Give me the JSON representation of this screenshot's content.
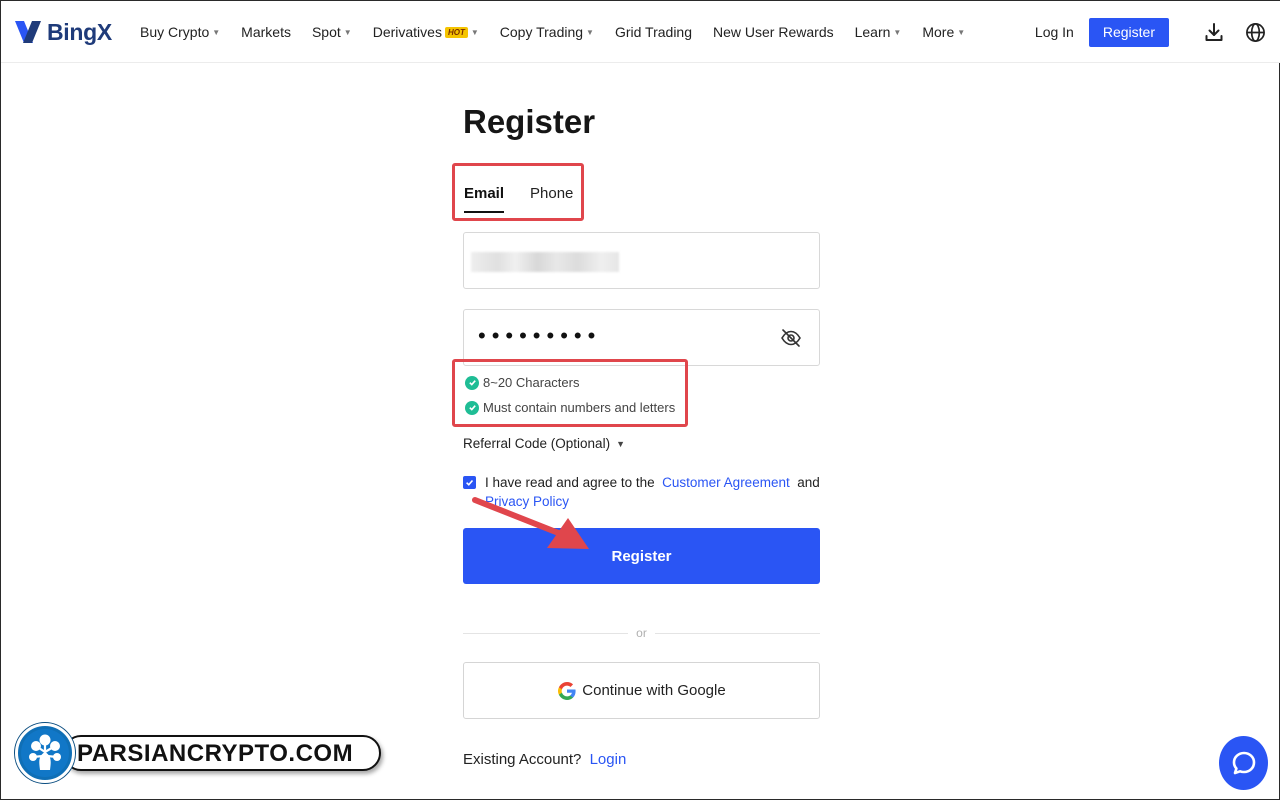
{
  "header": {
    "logo_text": "BingX",
    "nav": [
      {
        "label": "Buy Crypto",
        "caret": true
      },
      {
        "label": "Markets",
        "caret": false
      },
      {
        "label": "Spot",
        "caret": true
      },
      {
        "label": "Derivatives",
        "caret": true,
        "badge": "HOT"
      },
      {
        "label": "Copy Trading",
        "caret": true
      },
      {
        "label": "Grid Trading",
        "caret": false
      },
      {
        "label": "New User Rewards",
        "caret": false
      },
      {
        "label": "Learn",
        "caret": true
      },
      {
        "label": "More",
        "caret": true
      }
    ],
    "login_label": "Log In",
    "register_label": "Register",
    "icons": [
      "download-icon",
      "globe-icon"
    ]
  },
  "form": {
    "title": "Register",
    "tabs": [
      {
        "label": "Email",
        "active": true
      },
      {
        "label": "Phone",
        "active": false
      }
    ],
    "password_value": "•••••••••",
    "rules": [
      {
        "label": "8~20 Characters",
        "passed": true
      },
      {
        "label": "Must contain numbers and letters",
        "passed": true
      }
    ],
    "referral_label": "Referral Code (Optional)",
    "agree": {
      "checked": true,
      "prefix": "I have read and agree to the",
      "customer_agreement": "Customer Agreement",
      "and": "and",
      "privacy_policy": "Privacy Policy"
    },
    "submit_label": "Register",
    "divider_label": "or",
    "google_label": "Continue with Google",
    "existing_label": "Existing Account?",
    "login_link": "Login"
  },
  "watermark": {
    "text": "PARSIANCRYPTO.COM"
  },
  "colors": {
    "accent": "#2a55f4",
    "highlight": "#e0464c",
    "success": "#1fbd95"
  }
}
